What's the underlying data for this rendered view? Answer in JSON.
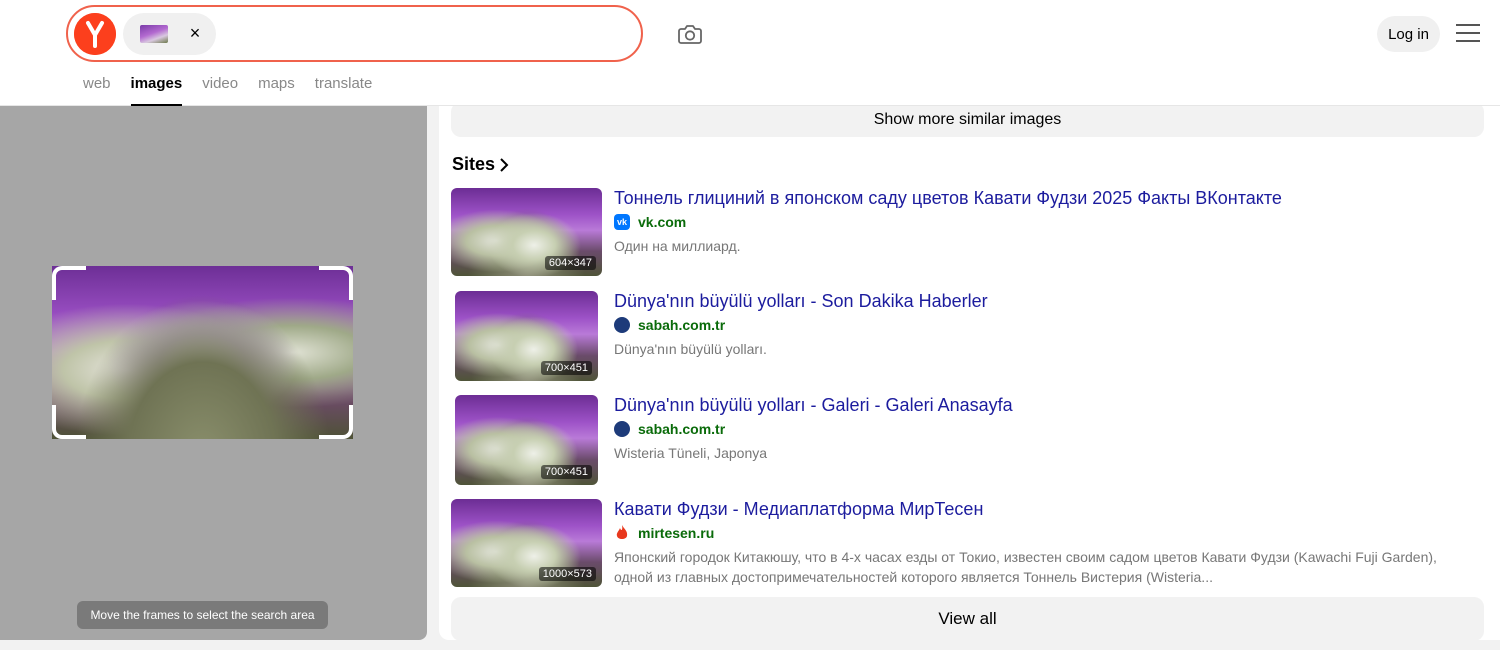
{
  "header": {
    "logo_letter": "Y",
    "clear_symbol": "×",
    "login_label": "Log in"
  },
  "nav": {
    "tabs": [
      {
        "label": "web",
        "active": false
      },
      {
        "label": "images",
        "active": true
      },
      {
        "label": "video",
        "active": false
      },
      {
        "label": "maps",
        "active": false
      },
      {
        "label": "translate",
        "active": false
      }
    ]
  },
  "left_panel": {
    "hint": "Move the frames to select the search area"
  },
  "right_panel": {
    "show_more_label": "Show more similar images",
    "sites_title": "Sites",
    "view_all_label": "View all",
    "results": [
      {
        "title": "Тоннель глициний в японском саду цветов Кавати Фудзи 2025 Факты ВКонтакте",
        "site": "vk.com",
        "favicon": "vk-icon",
        "description": "Один на миллиард.",
        "size": "604×347"
      },
      {
        "title": "Dünya'nın büyülü yolları - Son Dakika Haberler",
        "site": "sabah.com.tr",
        "favicon": "sabah-icon",
        "description": "Dünya'nın büyülü yolları.",
        "size": "700×451"
      },
      {
        "title": "Dünya'nın büyülü yolları - Galeri - Galeri Anasayfa",
        "site": "sabah.com.tr",
        "favicon": "sabah-icon",
        "description": "Wisteria Tüneli, Japonya",
        "size": "700×451"
      },
      {
        "title": "Кавати Фудзи - Медиаплатформа МирТесен",
        "site": "mirtesen.ru",
        "favicon": "flame-icon",
        "description": "Японский городок Китакюшу, что в 4-х часах езды от Токио, известен своим садом цветов Кавати Фудзи (Kawachi Fuji Garden), одной из главных достопримечательностей которого является Тоннель Вистерия (Wisteria...",
        "size": "1000×573"
      }
    ]
  },
  "colors": {
    "brand": "#fc3f1d",
    "search_border": "#f0624c",
    "link": "#1c1c9e",
    "site_green": "#0a6b0a"
  }
}
